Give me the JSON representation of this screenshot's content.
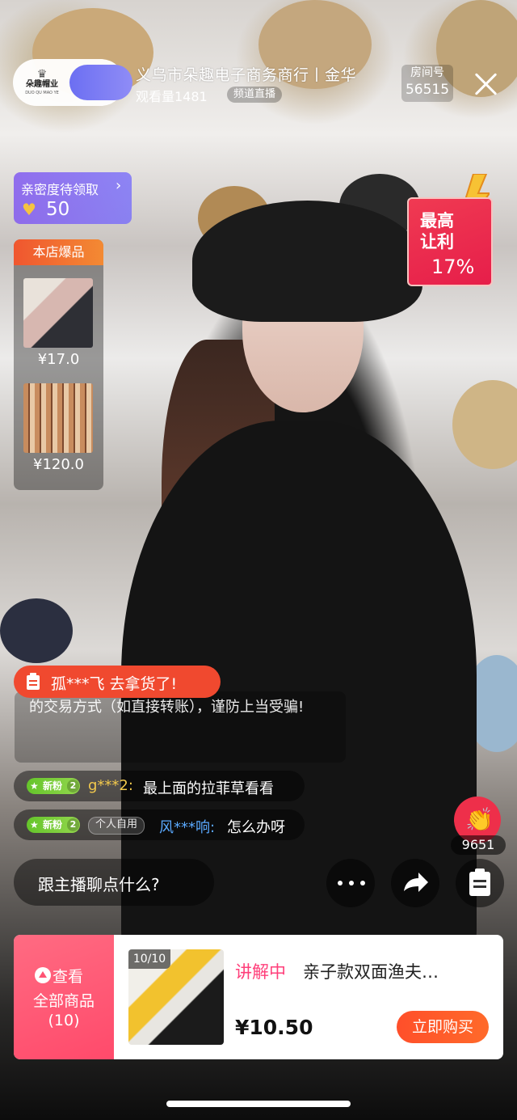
{
  "header": {
    "shop_logo_text": "朵趣帽业",
    "shop_logo_sub": "DUO QU MAO YE",
    "title": "义乌市朵趣电子商务商行丨金华",
    "viewers": "观看量1481",
    "channel_tag": "频道直播",
    "room_label": "房间号",
    "room_number": "56515"
  },
  "intimacy": {
    "label": "亲密度待领取",
    "value": "50"
  },
  "hot_products": {
    "title": "本店爆品",
    "items": [
      {
        "price": "¥17.0"
      },
      {
        "price": "¥120.0"
      }
    ]
  },
  "promo": {
    "line1": "最高",
    "line2": "让利",
    "percent": "17%"
  },
  "notification": {
    "text": "孤***飞 去拿货了!"
  },
  "system_message": {
    "text": "的交易方式（如直接转账），谨防上当受骗!"
  },
  "chat": [
    {
      "badge": "新粉",
      "level": "2",
      "user": "g***2:",
      "message": "最上面的拉菲草看看",
      "user_color": "#f2c94c"
    },
    {
      "badge": "新粉",
      "level": "2",
      "tag": "个人自用",
      "user": "风***响:",
      "message": "怎么办呀",
      "user_color": "#5aa9ff"
    }
  ],
  "likes": {
    "count": "9651"
  },
  "input": {
    "placeholder": "跟主播聊点什么?"
  },
  "product_card": {
    "view_label": "查看",
    "all_label": "全部商品",
    "count_label": "(10)",
    "image_counter": "10/10",
    "status": "讲解中",
    "name": "亲子款双面渔夫…",
    "price": "¥10.50",
    "buy_label": "立即购买"
  },
  "colors": {
    "accent_red": "#f0492f",
    "fan_green": "#65c52b",
    "promo_red": "#e61e4a",
    "follow_purple": "#6c6ff2"
  }
}
